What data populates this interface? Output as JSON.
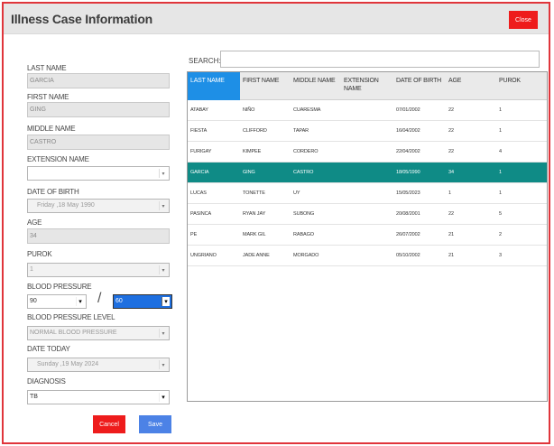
{
  "window": {
    "title": "Illness Case Information",
    "close_label": "Close"
  },
  "form": {
    "last_name": {
      "label": "LAST NAME",
      "value": "GARCIA"
    },
    "first_name": {
      "label": "FIRST NAME",
      "value": "GING"
    },
    "middle_name": {
      "label": "MIDDLE NAME",
      "value": "CASTRO"
    },
    "extension_name": {
      "label": "EXTENSION NAME",
      "value": ""
    },
    "date_of_birth": {
      "label": "DATE OF BIRTH",
      "value": "Friday  ,18   May   1990"
    },
    "age": {
      "label": "AGE",
      "value": "34"
    },
    "purok": {
      "label": "PUROK",
      "value": "1"
    },
    "blood_pressure": {
      "label": "BLOOD PRESSURE",
      "systolic": "90",
      "diastolic": "60",
      "separator": "/"
    },
    "blood_pressure_level": {
      "label": "BLOOD PRESSURE LEVEL",
      "value": "NORMAL BLOOD PRESSURE"
    },
    "date_today": {
      "label": "DATE TODAY",
      "value": "Sunday  ,19   May   2024"
    },
    "diagnosis": {
      "label": "DIAGNOSIS",
      "value": "TB"
    },
    "cancel_label": "Cancel",
    "save_label": "Save"
  },
  "search": {
    "label": "SEARCH:",
    "value": ""
  },
  "table": {
    "headers": [
      "LAST NAME",
      "FIRST NAME",
      "MIDDLE NAME",
      "EXTENSION NAME",
      "DATE OF BIRTH",
      "AGE",
      "PUROK"
    ],
    "rows": [
      [
        "ATABAY",
        "NIÑO",
        "CUARESMA",
        "",
        "07/01/2002",
        "22",
        "1"
      ],
      [
        "FIESTA",
        "CLIFFORD",
        "TAPAR",
        "",
        "16/04/2002",
        "22",
        "1"
      ],
      [
        "FURIGAY",
        "KIMPEE",
        "CORDERO",
        "",
        "22/04/2002",
        "22",
        "4"
      ],
      [
        "GARCIA",
        "GING",
        "CASTRO",
        "",
        "18/05/1990",
        "34",
        "1"
      ],
      [
        "LUCAS",
        "TONETTE",
        "UY",
        "",
        "15/05/2023",
        "1",
        "1"
      ],
      [
        "PASINCA",
        "RYAN JAY",
        "SUBONG",
        "",
        "20/08/2001",
        "22",
        "5"
      ],
      [
        "PE",
        "MARK GIL",
        "RABAGO",
        "",
        "26/07/2002",
        "21",
        "2"
      ],
      [
        "UNGRIANO",
        "JADE ANNE",
        "MORGADO",
        "",
        "05/10/2002",
        "21",
        "3"
      ]
    ],
    "selected_row": 3
  }
}
